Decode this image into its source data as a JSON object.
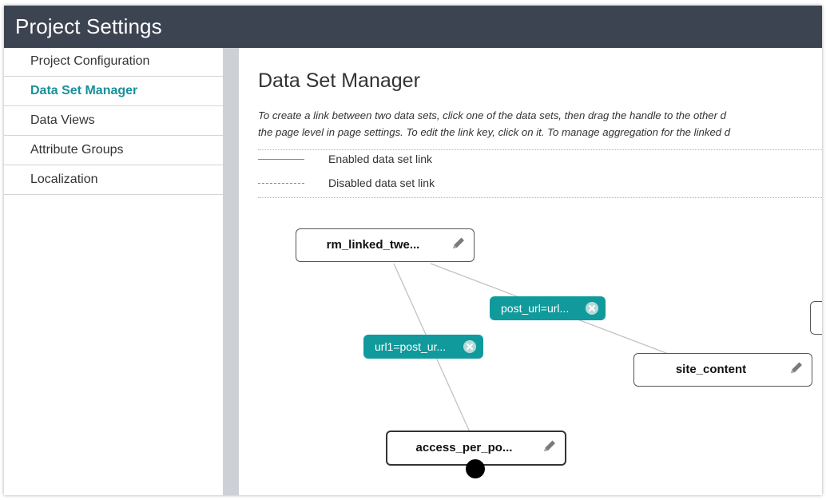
{
  "header": {
    "title": "Project Settings"
  },
  "sidebar": {
    "items": [
      {
        "label": "Project Configuration",
        "active": false
      },
      {
        "label": "Data Set Manager",
        "active": true
      },
      {
        "label": "Data Views",
        "active": false
      },
      {
        "label": "Attribute Groups",
        "active": false
      },
      {
        "label": "Localization",
        "active": false
      }
    ]
  },
  "main": {
    "title": "Data Set Manager",
    "description_line1": "To create a link between two data sets, click one of the data sets, then drag the handle to the other d",
    "description_line2": "the page level in page settings. To edit the link key, click on it. To manage aggregation for the linked d",
    "legend": {
      "enabled_label": "Enabled data set link",
      "disabled_label": "Disabled data set link"
    }
  },
  "graph": {
    "nodes": {
      "rm_linked": {
        "label": "rm_linked_twe...",
        "icon": "pencil-icon"
      },
      "site_content": {
        "label": "site_content",
        "icon": "pencil-icon"
      },
      "access_per_post": {
        "label": "access_per_po...",
        "icon": "pencil-icon"
      }
    },
    "links": {
      "post_url": {
        "label": "post_url=url...",
        "icon": "close-icon"
      },
      "url1": {
        "label": "url1=post_ur...",
        "icon": "close-icon"
      }
    }
  },
  "colors": {
    "header_bg": "#3d4451",
    "accent": "#18909a",
    "link_badge": "#109a9c",
    "divider": "#cdd1d6"
  }
}
